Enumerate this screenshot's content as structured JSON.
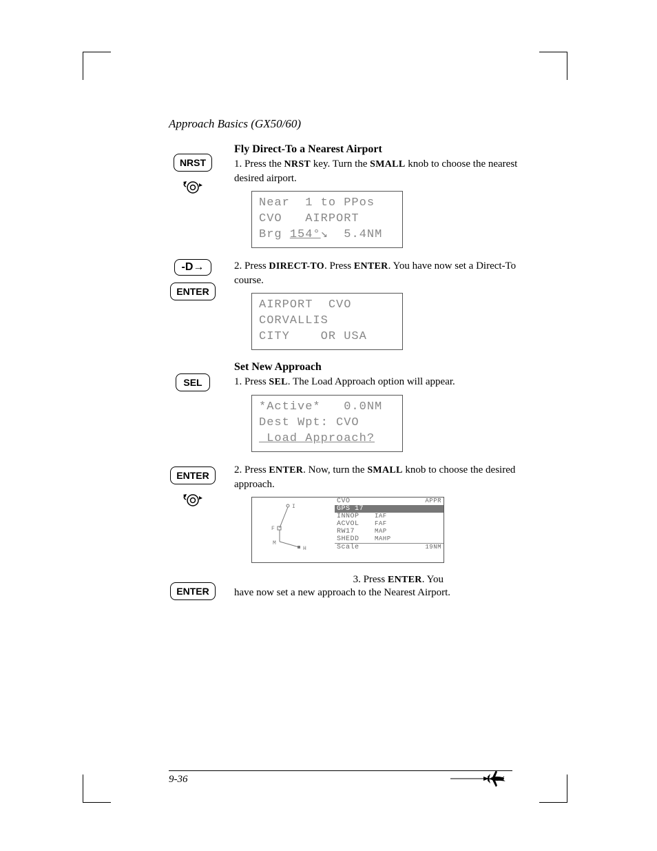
{
  "header": "Approach Basics (GX50/60)",
  "sec1": {
    "title": "Fly Direct-To a Nearest Airport",
    "step1_pre": "1. Press the ",
    "step1_key1": "NRST",
    "step1_mid": " key. Turn the ",
    "step1_key2": "SMALL",
    "step1_post": " knob to choose the nearest desired airport.",
    "keys": {
      "nrst": "NRST"
    },
    "lcd1": {
      "r1": "Near  1 to PPos",
      "r2": "CVO   AIRPORT",
      "r3a": "Brg ",
      "r3b": "154°",
      "r3c": "↘  5.4NM"
    },
    "step2_pre": "2. Press ",
    "step2_key1": "DIRECT-TO",
    "step2_mid": ". Press ",
    "step2_key2": "ENTER",
    "step2_post": ". You have now set a Direct-To course.",
    "keys2": {
      "dto": "-D→",
      "enter": "ENTER"
    },
    "lcd2": {
      "r1": "AIRPORT  CVO",
      "r2": "CORVALLIS",
      "r3": "CITY    OR USA"
    }
  },
  "sec2": {
    "title": "Set New Approach",
    "step1_pre": "1. Press ",
    "step1_key1": "SEL",
    "step1_post": ". The Load Approach option will appear.",
    "keys": {
      "sel": "SEL"
    },
    "lcd1": {
      "r1": "*Active*   0.0NM",
      "r2": "Dest Wpt: CVO",
      "r3": " Load Approach?"
    },
    "step2_pre": "2. Press ",
    "step2_key1": "ENTER",
    "step2_mid": ". Now, turn the ",
    "step2_key2": "SMALL",
    "step2_post": " knob to choose the desired approach.",
    "keys2": {
      "enter": "ENTER"
    },
    "appr": {
      "hdr_l": "CVO",
      "hdr_r": "APPR",
      "rows": [
        {
          "c1": "GPS 17",
          "c2": "",
          "sel": true
        },
        {
          "c1": "INNOP",
          "c2": "IAF"
        },
        {
          "c1": "ACVOL",
          "c2": "FAF"
        },
        {
          "c1": "RW17",
          "c2": "MAP"
        },
        {
          "c1": "SHEDD",
          "c2": "MAHP"
        }
      ],
      "scale_l": "Scale",
      "scale_r": "19NM",
      "map_labels": {
        "i": "I",
        "f": "F",
        "m": "M",
        "h": "H"
      }
    },
    "step3_pre": "3. Press ",
    "step3_key1": "ENTER",
    "step3_post": ". You",
    "step3_cont": "have now set a new approach to the Nearest Airport.",
    "keys3": {
      "enter": "ENTER"
    }
  },
  "footer": "9-36"
}
